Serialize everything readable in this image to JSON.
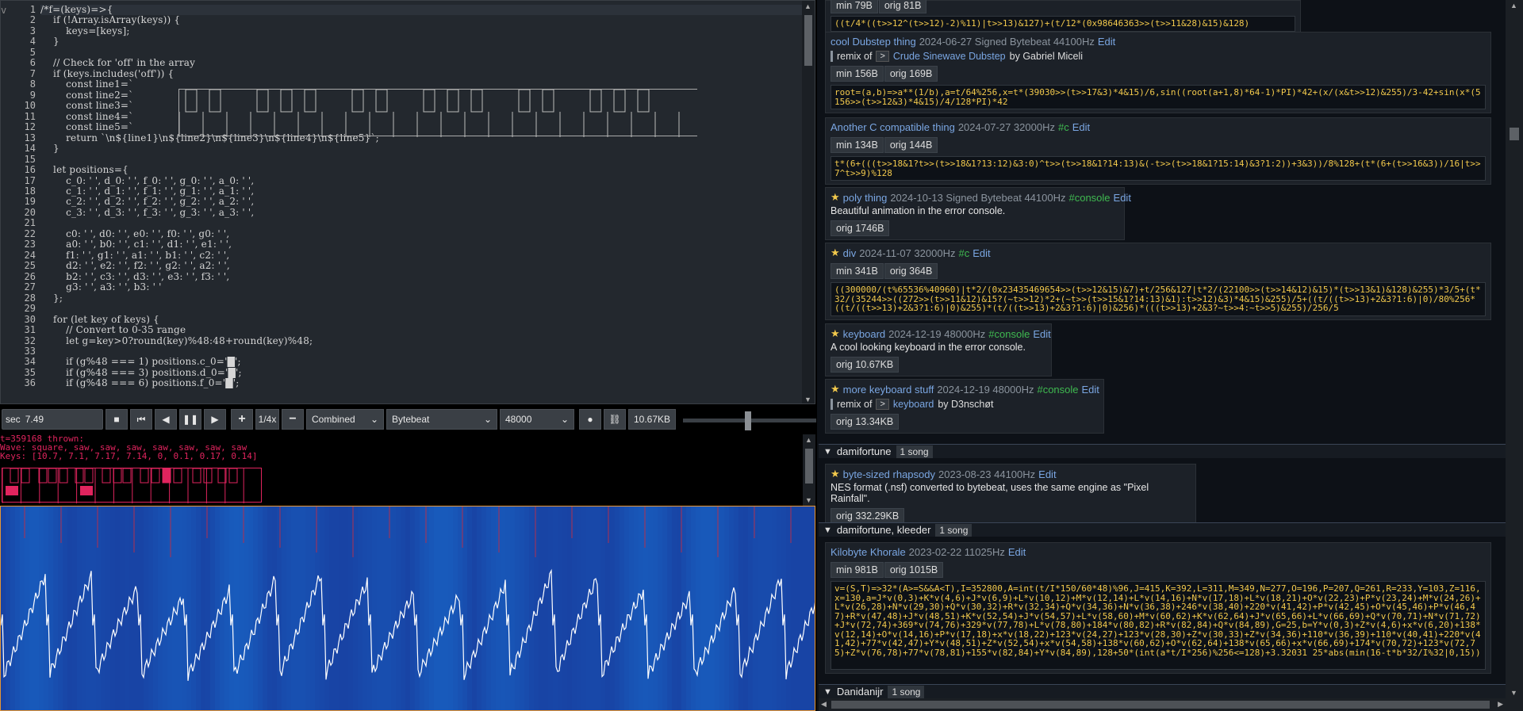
{
  "editor": {
    "lines": [
      "/*f=(keys)=>{",
      "    if (!Array.isArray(keys)) {",
      "        keys=[keys];",
      "    }",
      "",
      "    // Check for 'off' in the array",
      "    if (keys.includes('off')) {",
      "        const line1=`",
      "        const line2=`",
      "        const line3=`",
      "        const line4=`",
      "        const line5=`",
      "        return `\\n${line1}\\n${line2}\\n${line3}\\n${line4}\\n${line5}`;",
      "    }",
      "",
      "    let positions={",
      "        c_0: ' ', d_0: ' ', f_0: ' ', g_0: ' ', a_0: ' ',",
      "        c_1: ' ', d_1: ' ', f_1: ' ', g_1: ' ', a_1: ' ',",
      "        c_2: ' ', d_2: ' ', f_2: ' ', g_2: ' ', a_2: ' ',",
      "        c_3: ' ', d_3: ' ', f_3: ' ', g_3: ' ', a_3: ' ',",
      "",
      "        c0: ' ', d0: ' ', e0: ' ', f0: ' ', g0: ' ',",
      "        a0: ' ', b0: ' ', c1: ' ', d1: ' ', e1: ' ',",
      "        f1: ' ', g1: ' ', a1: ' ', b1: ' ', c2: ' ',",
      "        d2: ' ', e2: ' ', f2: ' ', g2: ' ', a2: ' ',",
      "        b2: ' ', c3: ' ', d3: ' ', e3: ' ', f3: ' ',",
      "        g3: ' ', a3: ' ', b3: ' '",
      "    };",
      "",
      "    for (let key of keys) {",
      "        // Convert to 0-35 range",
      "        let g=key>0?round(key)%48:48+round(key)%48;",
      "",
      "        if (g%48 === 1) positions.c_0='█';",
      "        if (g%48 === 3) positions.d_0='█';",
      "        if (g%48 === 6) positions.f_0='█';"
    ]
  },
  "controls": {
    "time_label": "sec",
    "time_value": "7.49",
    "speed": "1/4x",
    "mode": "Combined",
    "format": "Bytebeat",
    "rate": "48000",
    "size": "10.67KB"
  },
  "errors": {
    "line1": "t=359168 thrown:",
    "line2": "Wave: square, saw, saw, saw, saw, saw, saw, saw",
    "line3": "Keys: [10.7, 7.1, 7.17, 7.14, 0, 0.1, 0.17, 0.14]"
  },
  "library": {
    "top_pills": [
      "min 79B",
      "orig 81B"
    ],
    "top_code": "((t/4*((t>>12^(t>>12)-2)%11)|t>>13)&127)+(t/12*(0x98646363>>(t>>11&28)&15)&128)",
    "songs": [
      {
        "star": false,
        "name": "cool Dubstep thing",
        "meta": "2024-06-27 Signed Bytebeat 44100Hz",
        "tag": "",
        "edit": "Edit",
        "remix_of": "remix of",
        "remix_name": "Crude Sinewave Dubstep",
        "remix_by": "by Gabriel Miceli",
        "pills": [
          "min 156B",
          "orig 169B"
        ],
        "code": "root=(a,b)=>a**(1/b),a=t/64%256,x=t*(39030>>(t>>17&3)*4&15)/6,sin((root(a+1,8)*64-1)*PI)*42+(x/(x&t>>12)&255)/3-42+sin(x*(5156>>(t>>12&3)*4&15)/4/128*PI)*42"
      },
      {
        "star": false,
        "name": "Another C compatible thing",
        "meta": "2024-07-27 32000Hz",
        "tag": "#c",
        "edit": "Edit",
        "pills": [
          "min 134B",
          "orig 144B"
        ],
        "code": "t*(6+(((t>>18&1?t>>(t>>18&1?13:12)&3:0)^t>>(t>>18&1?14:13)&(-t>>(t>>18&1?15:14)&3?1:2))+3&3))/8%128+(t*(6+(t>>16&3))/16|t>>7^t>>9)%128"
      },
      {
        "star": true,
        "name": "poly thing",
        "meta": "2024-10-13 Signed Bytebeat 44100Hz",
        "tag": "#console",
        "edit": "Edit",
        "desc": "Beautiful animation in the error console.",
        "pills": [
          "orig 1746B"
        ]
      },
      {
        "star": true,
        "name": "div",
        "meta": "2024-11-07 32000Hz",
        "tag": "#c",
        "edit": "Edit",
        "pills": [
          "min 341B",
          "orig 364B"
        ],
        "code": "((300000/(t%65536%40960)|t*2/(0x23435469654>>(t>>12&15)&7)+t/256&127|t*2/(22100>>(t>>14&12)&15)*(t>>13&1)&128)&255)*3/5+(t*32/(35244>>((272>>(t>>11&12)&15?(~t>>12)*2+(~t>>(t>>15&1?14:13)&1):t>>12)&3)*4&15)&255)/5+((t/((t>>13)+2&3?1:6)|0)/80%256*((t/((t>>13)+2&3?1:6)|0)&255)*(t/((t>>13)+2&3?1:6)|0)&256)*(((t>>13)+2&3?~t>>4:~t>>5)&255)/256/5"
      },
      {
        "star": true,
        "name": "keyboard",
        "meta": "2024-12-19 48000Hz",
        "tag": "#console",
        "edit": "Edit",
        "desc": "A cool looking keyboard in the error console.",
        "pills": [
          "orig 10.67KB"
        ]
      },
      {
        "star": true,
        "name": "more keyboard stuff",
        "meta": "2024-12-19 48000Hz",
        "tag": "#console",
        "edit": "Edit",
        "remix_of": "remix of",
        "remix_name": "keyboard",
        "remix_by": "by D3nschøt",
        "pills": [
          "orig 13.34KB"
        ]
      }
    ],
    "group1": {
      "name": "damifortune",
      "count": "1 song"
    },
    "song_g1": {
      "star": true,
      "name": "byte-sized rhapsody",
      "meta": "2023-08-23 44100Hz",
      "edit": "Edit",
      "desc": "NES format (.nsf) converted to bytebeat, uses the same engine as \"Pixel Rainfall\".",
      "pills": [
        "orig 332.29KB"
      ]
    },
    "group2": {
      "name": "damifortune, kleeder",
      "count": "1 song"
    },
    "song_g2": {
      "name": "Kilobyte Khorale",
      "meta": "2023-02-22 11025Hz",
      "edit": "Edit",
      "pills": [
        "min 981B",
        "orig 1015B"
      ],
      "code": "v=(S,T)=>32*(A>=S&&A<T),I=352800,A=int(t/I*150/60*48)%96,J=415,K=392,L=311,M=349,N=277,O=196,P=207,Q=261,R=233,Y=103,Z=116,x=130,a=J*v(0,3)+K*v(4,6)+J*v(6,9)+L*v(10,12)+M*v(12,14)+L*v(14,16)+N*v(17,18)+L*v(18,21)+O*v(22,23)+P*v(23,24)+M*v(24,26)+L*v(26,28)+N*v(29,30)+Q*v(30,32)+R*v(32,34)+Q*v(34,36)+N*v(36,38)+246*v(38,40)+220*v(41,42)+P*v(42,45)+O*v(45,46)+P*v(46,47)+R*v(47,48)+J*v(48,51)+K*v(52,54)+J*v(54,57)+L*v(58,60)+M*v(60,62)+K*v(62,64)+J*v(65,66)+L*v(66,69)+Q*v(70,71)+N*v(71,72)+J*v(72,74)+369*v(74,76)+329*v(77,78)+L*v(78,80)+184*v(80,82)+R*v(82,84)+Q*v(84,89),G=25,b=Y*v(0,3)+Z*v(4,6)+x*v(6,20)+138*v(12,14)+O*v(14,16)+P*v(17,18)+x*v(18,22)+123*v(24,27)+123*v(28,30)+Z*v(30,33)+Z*v(34,36)+110*v(36,39)+110*v(40,41)+220*v(41,42)+77*v(42,47)+Y*v(48,51)+Z*v(52,54)+x*v(54,58)+138*v(60,62)+O*v(62,64)+138*v(65,66)+x*v(66,69)+174*v(70,72)+123*v(72,75)+Z*v(76,78)+77*v(78,81)+155*v(82,84)+Y*v(84,89),128+50*(int(a*t/I*256)%256<=128)+3.32031 25*abs(min(16-t*b*32/I%32|0,15))"
    },
    "group3": {
      "name": "Danidanijr",
      "count": "1 song"
    }
  },
  "icons": {
    "stop": "stop-icon",
    "rewind": "skip-back-icon",
    "back": "play-backward-icon",
    "pause": "pause-icon",
    "forward": "play-forward-icon",
    "plus": "plus-icon",
    "minus": "minus-icon",
    "record": "record-icon",
    "link": "link-icon"
  },
  "colors": {
    "error_text": "#e0245e",
    "scope_bg": "#1e4f8c",
    "scope_border": "#e69533",
    "song_name": "#7aa6e2",
    "hashtag": "#3fb950",
    "code_text": "#f2c94c"
  }
}
